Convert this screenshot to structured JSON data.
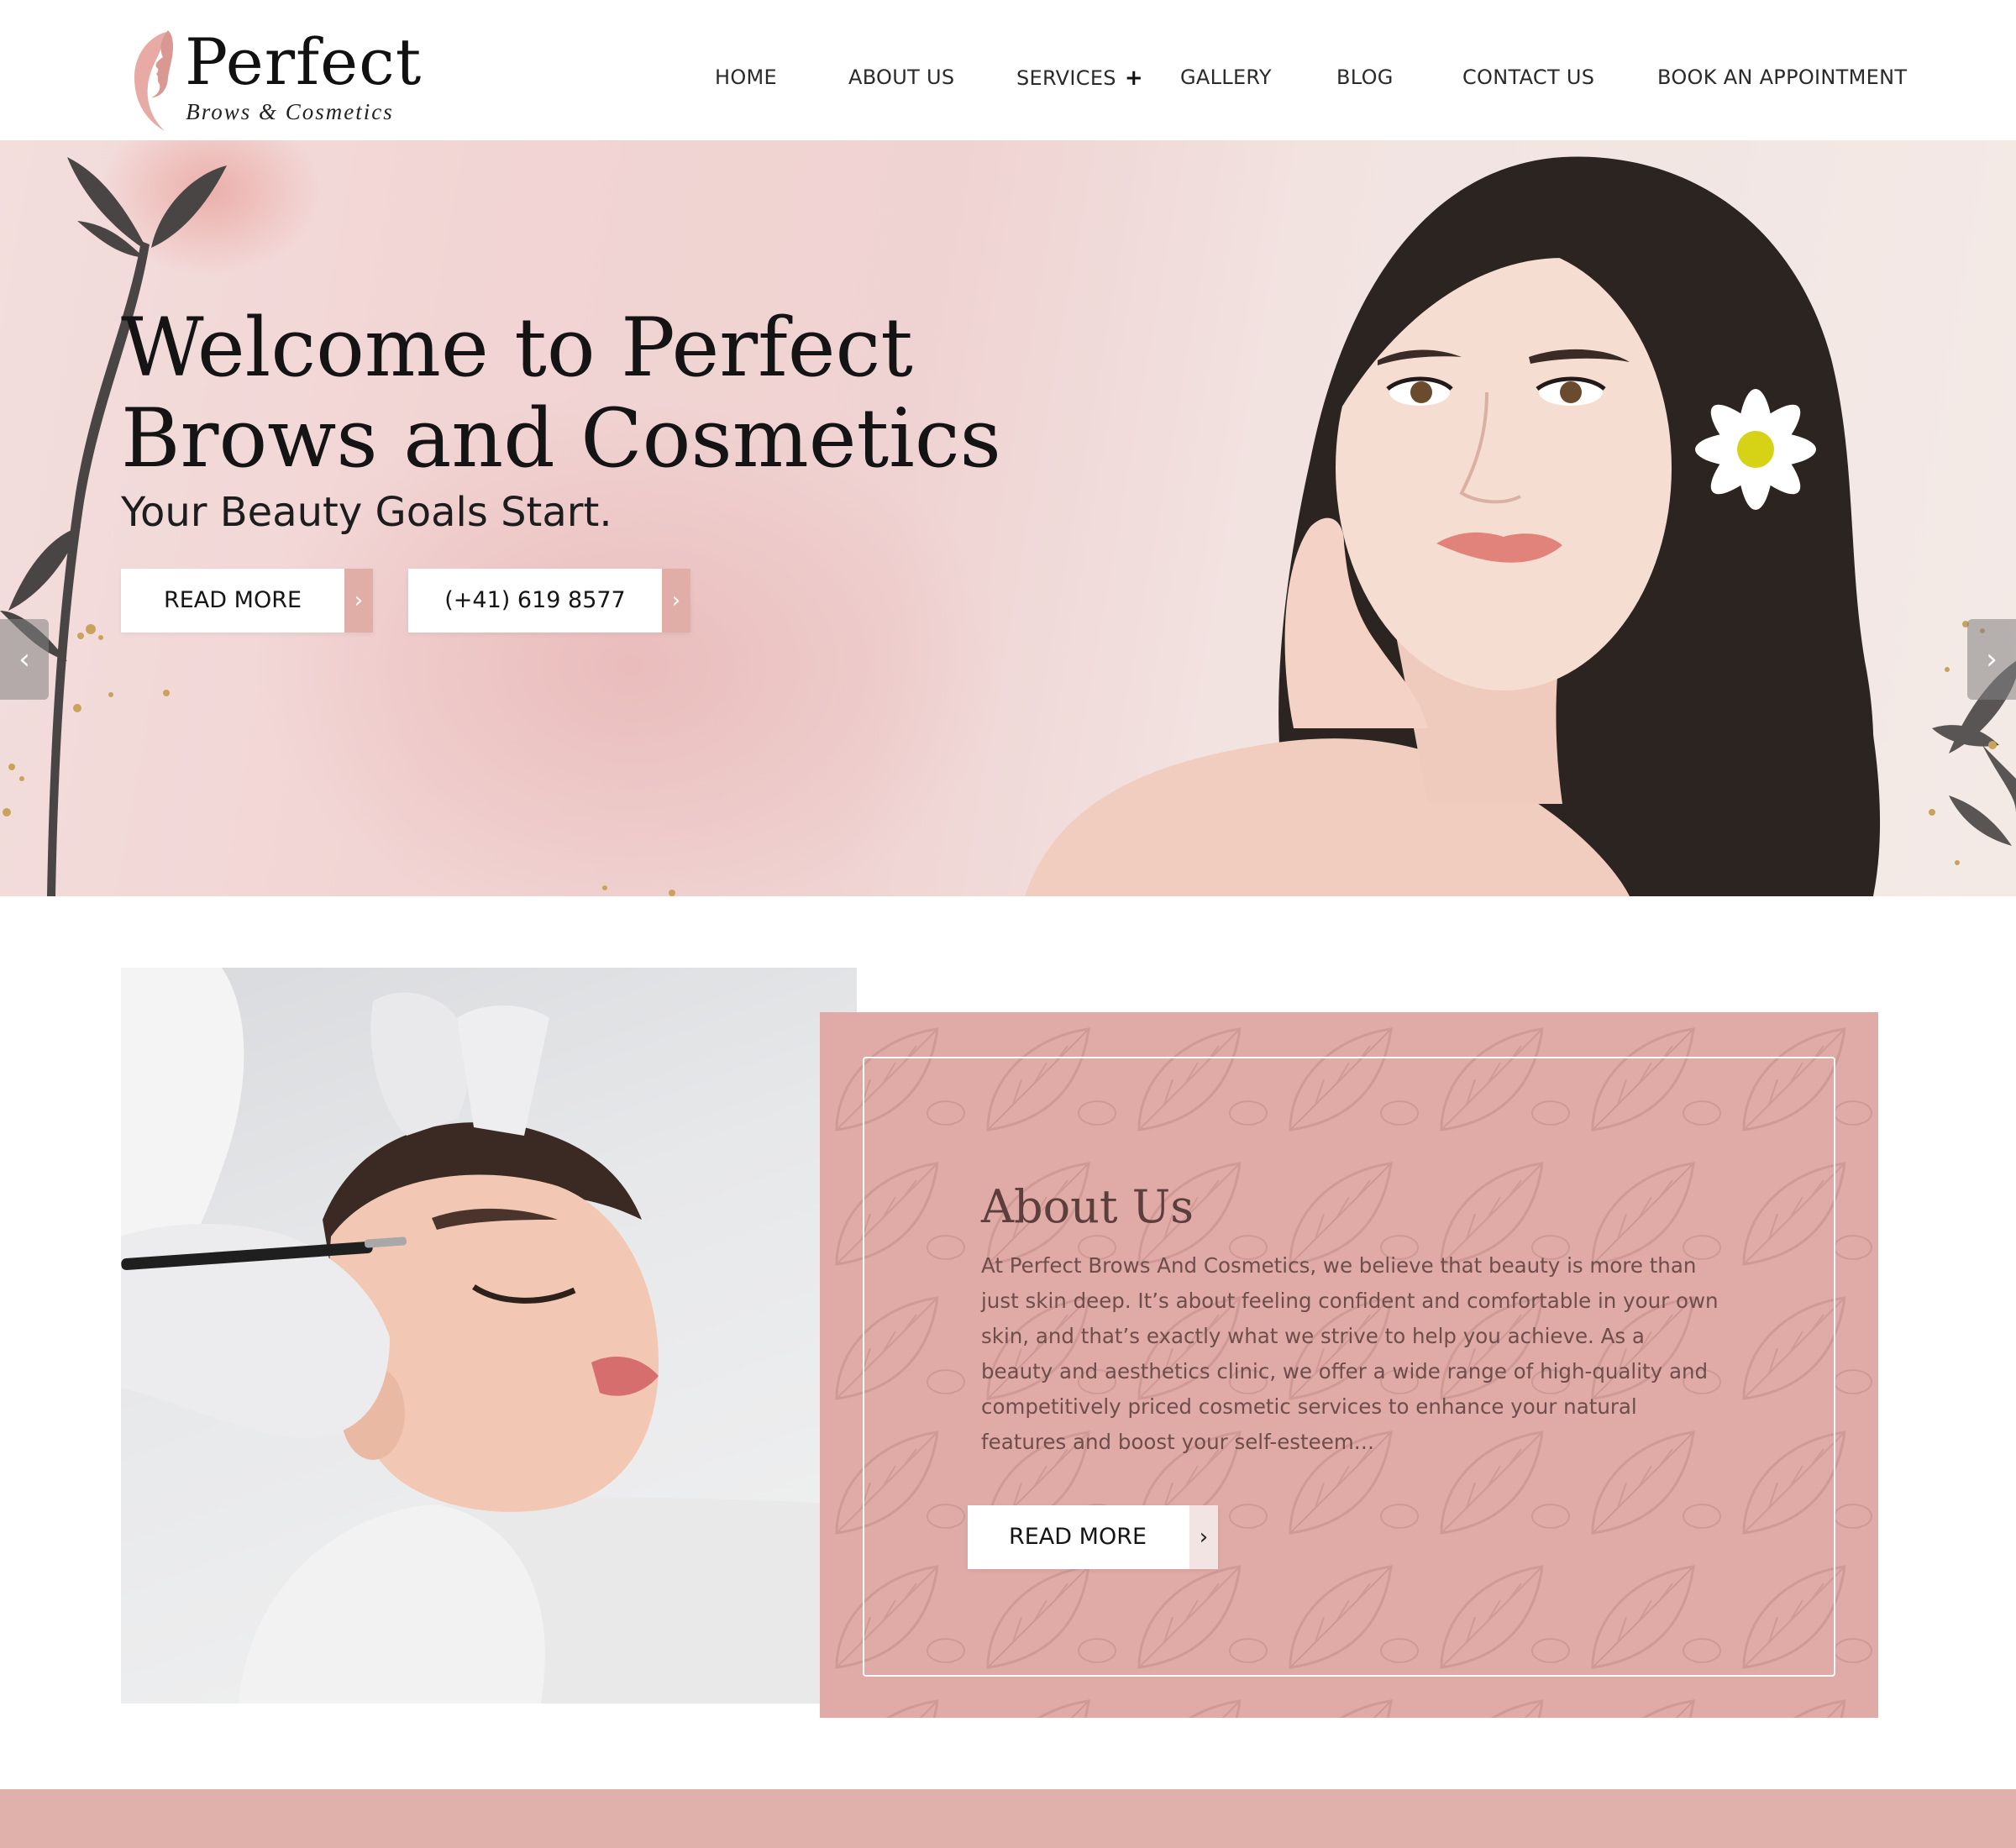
{
  "brand": {
    "name": "Perfect",
    "tagline": "Brows & Cosmetics",
    "accent_color": "#e1aea7",
    "card_color": "#e0aaa6"
  },
  "nav": {
    "items": [
      {
        "label": "HOME"
      },
      {
        "label": "ABOUT US"
      },
      {
        "label": "SERVICES",
        "has_submenu": true,
        "submenu_icon": "+"
      },
      {
        "label": "GALLERY"
      },
      {
        "label": "BLOG"
      },
      {
        "label": "CONTACT US"
      },
      {
        "label": "BOOK AN APPOINTMENT"
      }
    ]
  },
  "hero": {
    "title_line1": "Welcome to Perfect",
    "title_line2": "Brows and Cosmetics",
    "subtitle": "Your Beauty Goals Start.",
    "read_more_label": "READ MORE",
    "phone_label": "(+41) 619 8577",
    "button_arrow": "›",
    "prev_arrow": "‹",
    "next_arrow": "›"
  },
  "about": {
    "heading": "About Us",
    "body": "At Perfect Brows And Cosmetics, we believe that beauty is more than just skin deep. It’s about feeling confident and comfortable in your own skin, and that’s exactly what we strive to help you achieve. As a beauty and aesthetics clinic, we offer a wide range of high-quality and competitively priced cosmetic services to enhance your natural features and boost your self-esteem…",
    "read_more_label": "READ MORE",
    "button_arrow": "›"
  }
}
